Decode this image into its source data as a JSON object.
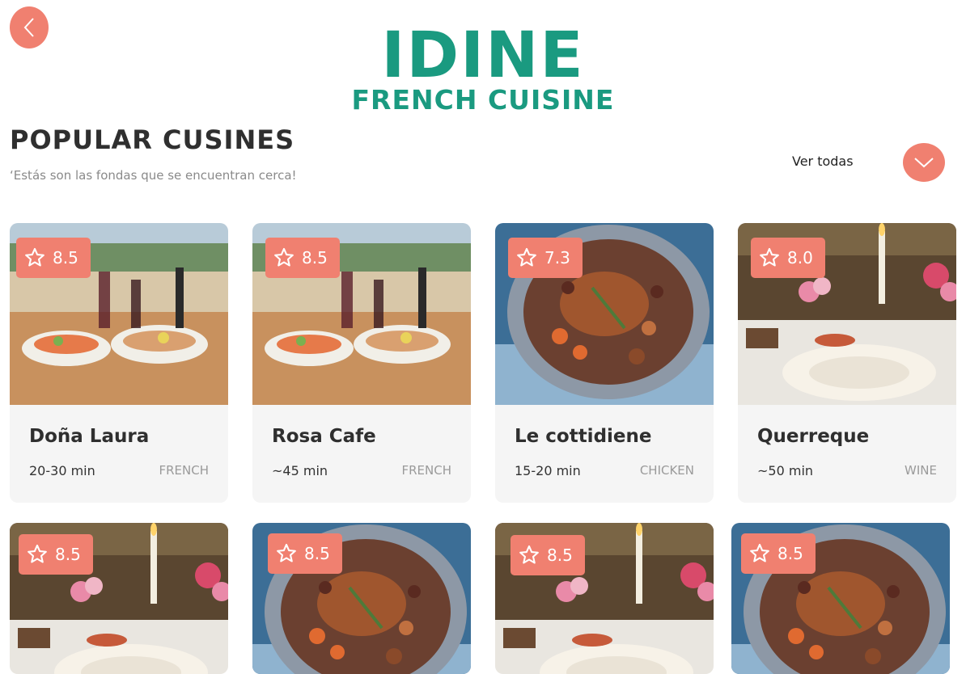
{
  "header": {
    "brand": "IDINE",
    "subtitle": "FRENCH CUISINE"
  },
  "section": {
    "title": "POPULAR CUSINES",
    "subtitle": "‘Estás son las fondas que se encuentran cerca!",
    "see_all": "Ver todas"
  },
  "colors": {
    "accent": "#f08070",
    "brand": "#1a9a80"
  },
  "cards": [
    {
      "rating": "8.5",
      "name": "Doña Laura",
      "time": "20-30 min",
      "tag": "FRENCH",
      "image": "salad-wine-terrace"
    },
    {
      "rating": "8.5",
      "name": "Rosa Cafe",
      "time": "~45 min",
      "tag": "FRENCH",
      "image": "salad-wine-terrace"
    },
    {
      "rating": "7.3",
      "name": "Le cottidiene",
      "time": "15-20 min",
      "tag": "CHICKEN",
      "image": "chicken-stew"
    },
    {
      "rating": "8.0",
      "name": "Querreque",
      "time": "~50 min",
      "tag": "WINE",
      "image": "table-candles-roses"
    },
    {
      "rating": "8.5",
      "image": "table-candles-roses"
    },
    {
      "rating": "8.5",
      "image": "chicken-stew"
    },
    {
      "rating": "8.5",
      "image": "table-candles-roses"
    },
    {
      "rating": "8.5",
      "image": "chicken-stew"
    }
  ]
}
